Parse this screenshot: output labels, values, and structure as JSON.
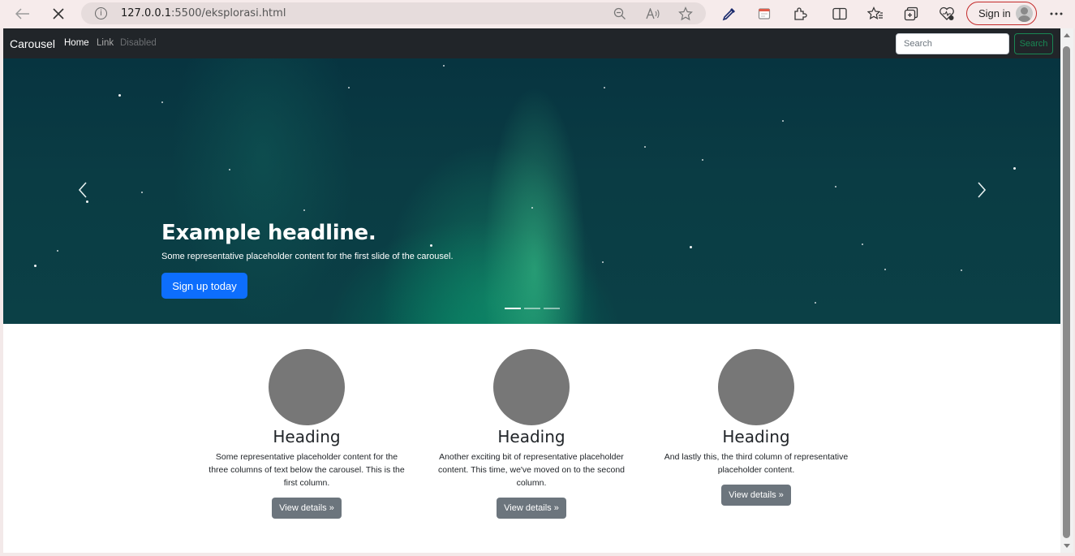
{
  "browser": {
    "url_host": "127.0.0.1",
    "url_path": ":5500/eksplorasi.html",
    "signin_label": "Sign in",
    "icons": [
      "back-arrow-icon",
      "stop-loading-icon",
      "info-icon",
      "zoom-out-icon",
      "read-aloud-icon",
      "favorite-star-icon",
      "eyedropper-icon",
      "web-capture-icon",
      "extensions-icon",
      "split-screen-icon",
      "favorites-icon",
      "collections-icon",
      "browser-essentials-icon",
      "more-menu-icon"
    ]
  },
  "navbar": {
    "brand": "Carousel",
    "links": [
      "Home",
      "Link",
      "Disabled"
    ],
    "search_placeholder": "Search",
    "search_button": "Search"
  },
  "carousel": {
    "headline": "Example headline.",
    "caption": "Some representative placeholder content for the first slide of the carousel.",
    "button": "Sign up today",
    "slide_count": 3,
    "active_slide": 1
  },
  "columns": [
    {
      "heading": "Heading",
      "text": "Some representative placeholder content for the three columns of text below the carousel. This is the first column.",
      "button": "View details »"
    },
    {
      "heading": "Heading",
      "text": "Another exciting bit of representative placeholder content. This time, we've moved on to the second column.",
      "button": "View details »"
    },
    {
      "heading": "Heading",
      "text": "And lastly this, the third column of representative placeholder content.",
      "button": "View details »"
    }
  ],
  "colors": {
    "navbar_bg": "#212529",
    "primary": "#0d6efd",
    "secondary": "#6c757d",
    "success": "#198754",
    "placeholder_circle": "#777777"
  }
}
